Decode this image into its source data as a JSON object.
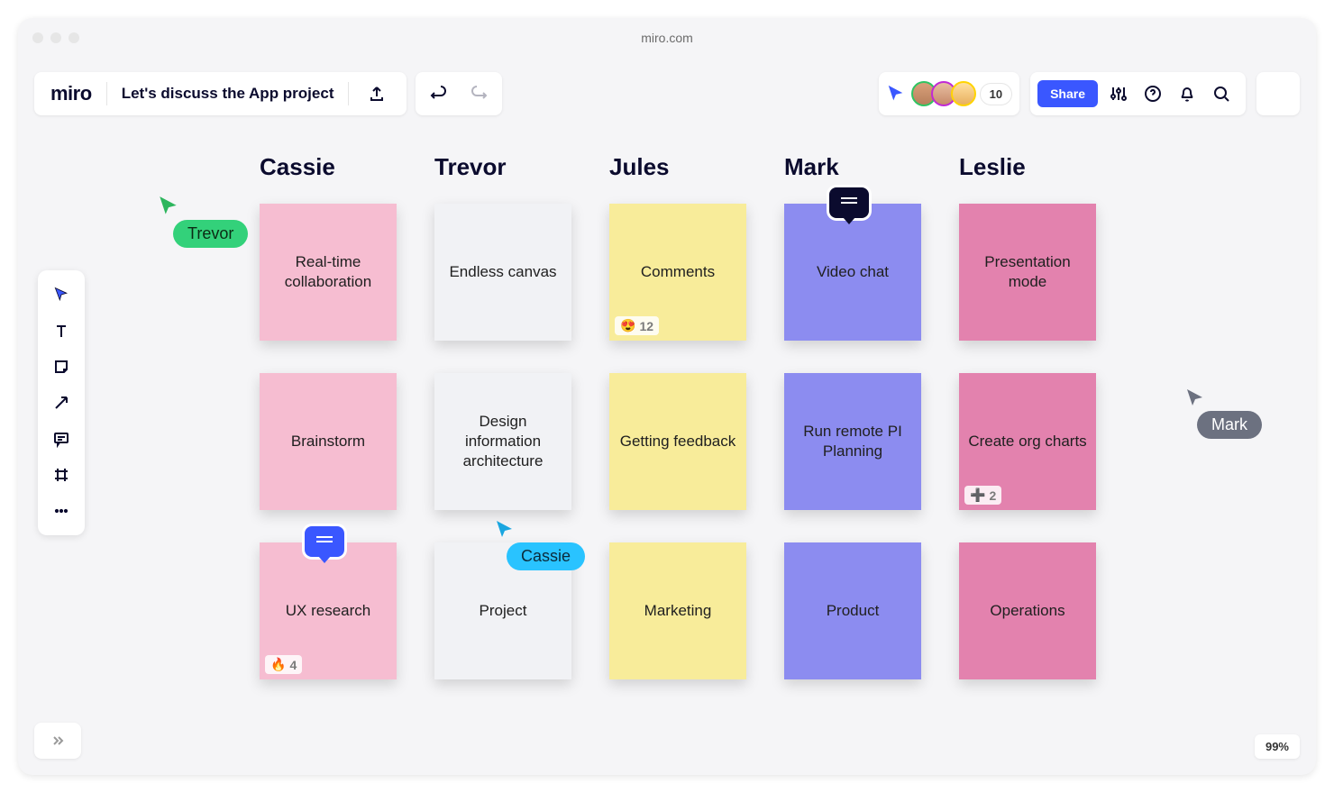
{
  "browser": {
    "url": "miro.com"
  },
  "header": {
    "brand": "miro",
    "board_title": "Let's discuss the App project",
    "share_label": "Share",
    "presence_count": "10"
  },
  "columns": [
    {
      "name": "Cassie",
      "color": "pink",
      "notes": [
        {
          "text": "Real-time collaboration"
        },
        {
          "text": "Brainstorm"
        },
        {
          "text": "UX research",
          "reaction_emoji": "🔥",
          "reaction_count": "4",
          "bubble": "blue"
        }
      ]
    },
    {
      "name": "Trevor",
      "color": "paper",
      "notes": [
        {
          "text": "Endless canvas"
        },
        {
          "text": "Design information architecture"
        },
        {
          "text": "Project"
        }
      ]
    },
    {
      "name": "Jules",
      "color": "yellow",
      "notes": [
        {
          "text": "Comments",
          "reaction_emoji": "😍",
          "reaction_count": "12"
        },
        {
          "text": "Getting feedback"
        },
        {
          "text": "Marketing"
        }
      ]
    },
    {
      "name": "Mark",
      "color": "purple",
      "notes": [
        {
          "text": "Video chat",
          "bubble": "black"
        },
        {
          "text": "Run remote PI Planning"
        },
        {
          "text": "Product"
        }
      ]
    },
    {
      "name": "Leslie",
      "color": "magenta",
      "notes": [
        {
          "text": "Presentation mode"
        },
        {
          "text": "Create org charts",
          "reaction_emoji": "➕",
          "reaction_count": "2"
        },
        {
          "text": "Operations"
        }
      ]
    }
  ],
  "cursors": {
    "trevor": {
      "label": "Trevor"
    },
    "cassie": {
      "label": "Cassie"
    },
    "mark": {
      "label": "Mark"
    }
  },
  "footer": {
    "zoom": "99%"
  }
}
